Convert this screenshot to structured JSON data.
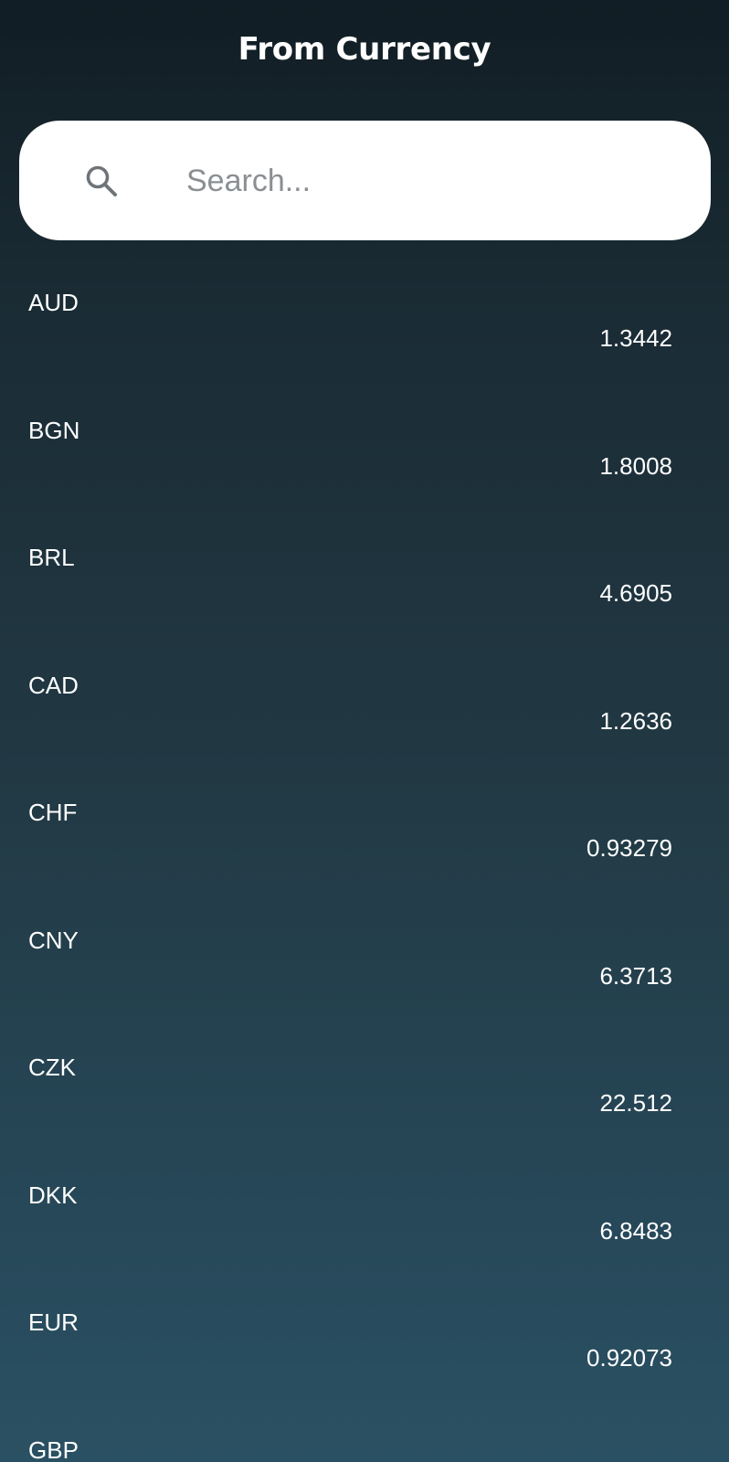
{
  "header": {
    "title": "From Currency"
  },
  "search": {
    "placeholder": "Search...",
    "value": "",
    "icon": "search-icon"
  },
  "currencies": [
    {
      "code": "AUD",
      "rate": "1.3442"
    },
    {
      "code": "BGN",
      "rate": "1.8008"
    },
    {
      "code": "BRL",
      "rate": "4.6905"
    },
    {
      "code": "CAD",
      "rate": "1.2636"
    },
    {
      "code": "CHF",
      "rate": "0.93279"
    },
    {
      "code": "CNY",
      "rate": "6.3713"
    },
    {
      "code": "CZK",
      "rate": "22.512"
    },
    {
      "code": "DKK",
      "rate": "6.8483"
    },
    {
      "code": "EUR",
      "rate": "0.92073"
    },
    {
      "code": "GBP",
      "rate": ""
    }
  ],
  "colors": {
    "background_top": "#111d24",
    "background_bottom": "#2a5163",
    "text": "#ffffff",
    "search_bg": "#ffffff",
    "placeholder": "#8a8f94"
  }
}
